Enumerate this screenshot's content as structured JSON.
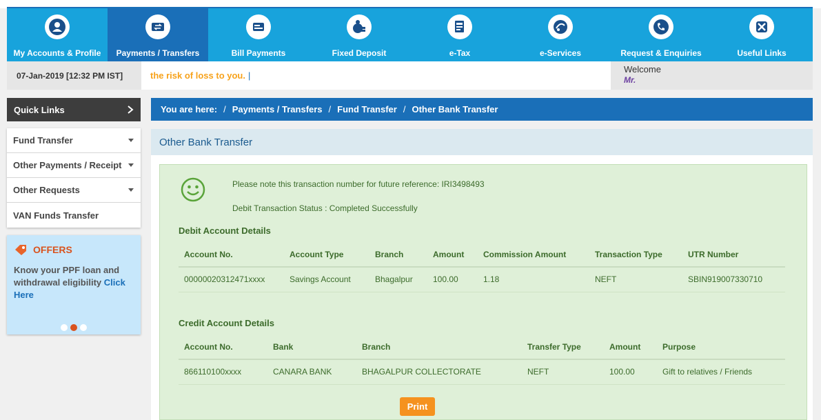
{
  "nav": {
    "items": [
      {
        "label": "My Accounts & Profile",
        "icon": "user-icon"
      },
      {
        "label": "Payments / Transfers",
        "icon": "transfer-icon"
      },
      {
        "label": "Bill Payments",
        "icon": "bill-icon"
      },
      {
        "label": "Fixed Deposit",
        "icon": "deposit-icon"
      },
      {
        "label": "e-Tax",
        "icon": "tax-icon"
      },
      {
        "label": "e-Services",
        "icon": "eservices-icon"
      },
      {
        "label": "Request & Enquiries",
        "icon": "phone-icon"
      },
      {
        "label": "Useful Links",
        "icon": "links-icon"
      }
    ],
    "active_index": 1
  },
  "info": {
    "datetime": "07-Jan-2019 [12:32 PM IST]",
    "ticker": "the risk of loss to you.",
    "ticker_cursor": "|",
    "welcome": "Welcome",
    "user": "Mr."
  },
  "sidebar": {
    "quick_links": "Quick Links",
    "items": [
      {
        "label": "Fund Transfer",
        "dropdown": true
      },
      {
        "label": "Other Payments / Receipt",
        "dropdown": true
      },
      {
        "label": "Other Requests",
        "dropdown": true
      },
      {
        "label": "VAN Funds Transfer",
        "dropdown": false
      }
    ],
    "offers": {
      "title": "OFFERS",
      "text": "Know your PPF loan and withdrawal eligibility",
      "link": "Click Here",
      "slide_count": 3,
      "active_slide": 1
    }
  },
  "breadcrumb": {
    "prefix": "You are here:",
    "items": [
      "Payments / Transfers",
      "Fund Transfer",
      "Other Bank Transfer"
    ]
  },
  "main": {
    "title": "Other Bank Transfer",
    "reference_msg": "Please note this transaction number for future reference: IRI3498493",
    "status_msg": "Debit Transaction Status : Completed Successfully",
    "debit": {
      "title": "Debit Account Details",
      "headers": [
        "Account No.",
        "Account Type",
        "Branch",
        "Amount",
        "Commission Amount",
        "Transaction Type",
        "UTR Number"
      ],
      "row": [
        "00000020312471xxxx",
        "Savings Account",
        "Bhagalpur",
        "100.00",
        "1.18",
        "NEFT",
        "SBIN919007330710"
      ]
    },
    "credit": {
      "title": "Credit Account Details",
      "headers": [
        "Account No.",
        "Bank",
        "Branch",
        "Transfer Type",
        "Amount",
        "Purpose"
      ],
      "row": [
        "866110100xxxx",
        "CANARA BANK",
        "BHAGALPUR COLLECTORATE",
        "NEFT",
        "100.00",
        "Gift to relatives / Friends"
      ]
    },
    "print_label": "Print"
  },
  "colors": {
    "nav_bg": "#18a3dc",
    "nav_active": "#1a6fb8",
    "success_bg": "#dff0d8",
    "success_text": "#3c6b2b",
    "accent_orange": "#f5921f",
    "offer_bg": "#c7e7fb"
  }
}
